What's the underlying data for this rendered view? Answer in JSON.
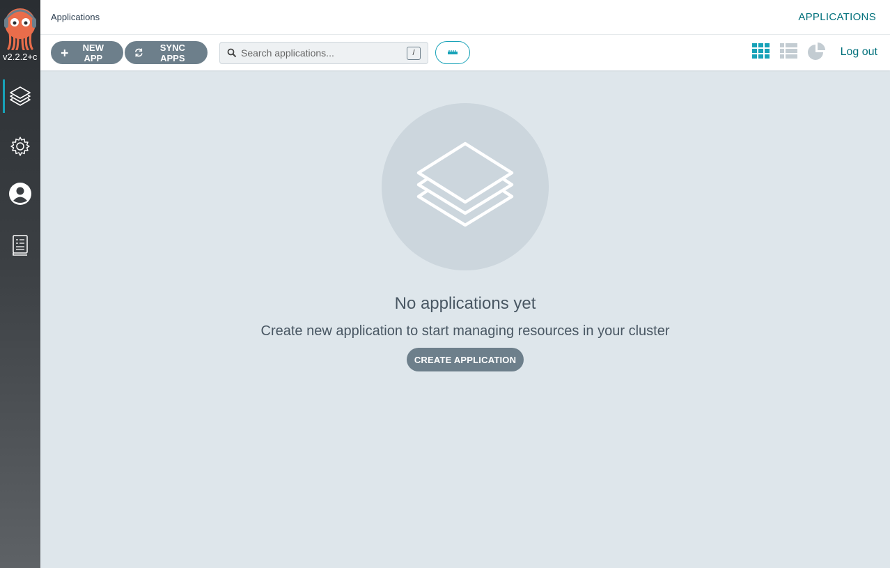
{
  "sidebar": {
    "version": "v2.2.2+c",
    "logo_icon": "argo-octopus-logo",
    "items": [
      {
        "name": "applications",
        "icon": "layers-icon",
        "active": true
      },
      {
        "name": "settings",
        "icon": "gear-icon",
        "active": false
      },
      {
        "name": "user-info",
        "icon": "user-icon",
        "active": false
      },
      {
        "name": "documentation",
        "icon": "book-icon",
        "active": false
      }
    ]
  },
  "header": {
    "title": "Applications",
    "section": "APPLICATIONS"
  },
  "toolbar": {
    "new_app_label": "NEW APP",
    "sync_apps_label": "SYNC APPS",
    "search_placeholder": "Search applications...",
    "search_shortcut": "/",
    "logout_label": "Log out"
  },
  "colors": {
    "accent": "#17a2b8",
    "link": "#00707b",
    "button": "#6d7f8b",
    "background": "#dee6eb"
  },
  "empty_state": {
    "title": "No applications yet",
    "subtitle": "Create new application to start managing resources in your cluster",
    "create_label": "CREATE APPLICATION"
  }
}
